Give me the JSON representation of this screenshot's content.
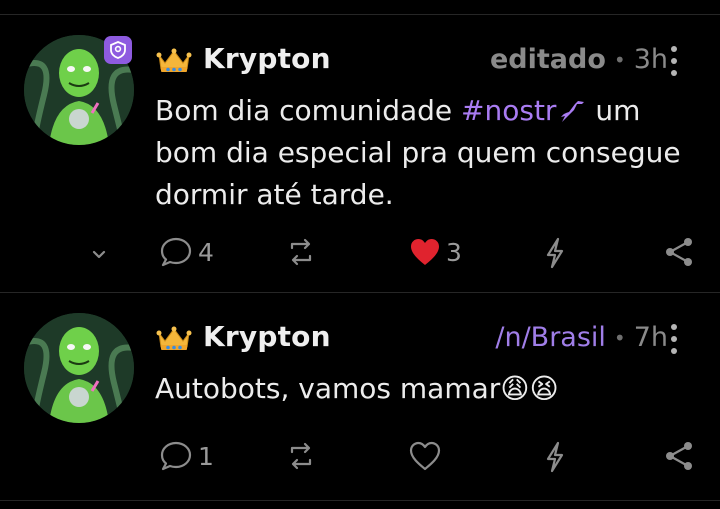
{
  "posts": [
    {
      "author": "Krypton",
      "meta_label": "editado",
      "time": "3h",
      "content": {
        "before": "Bom dia comunidade ",
        "hashtag": "#nostr",
        "after": " um bom dia especial pra quem consegue dormir até tarde."
      },
      "replies": "4",
      "likes": "3",
      "liked": true,
      "verified": true
    },
    {
      "author": "Krypton",
      "meta_label": "/n/Brasil",
      "time": "7h",
      "content": {
        "before": "Autobots, vamos mamar",
        "emoji": "😩😫"
      },
      "replies": "1",
      "liked": false,
      "verified": false
    }
  ],
  "icons": {
    "crown": "crown-icon",
    "reply": "speech-bubble-icon",
    "repost": "repost-icon",
    "like": "heart-icon",
    "zap": "lightning-icon",
    "share": "share-icon",
    "expand": "chevron-down-icon",
    "menu": "kebab-menu-icon",
    "badge": "shield-badge-icon"
  },
  "colors": {
    "accent": "#a97cf2",
    "like": "#e0232e",
    "muted": "#8c8c8c",
    "background": "#000000"
  }
}
